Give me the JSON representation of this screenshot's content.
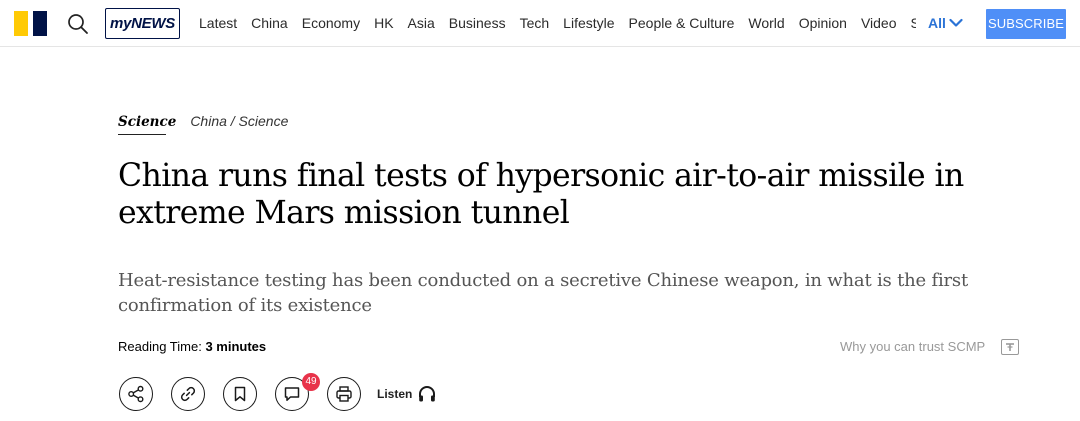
{
  "header": {
    "logo_name": "scmp-logo",
    "colors": {
      "logo_yellow": "#FFCA05",
      "logo_navy": "#001246",
      "accent": "#4f8ff7",
      "nav_more": "#2b73d6",
      "badge": "#e8334a"
    },
    "mynews_label": "myNEWS",
    "nav": [
      "Latest",
      "China",
      "Economy",
      "HK",
      "Asia",
      "Business",
      "Tech",
      "Lifestyle",
      "People & Culture",
      "World",
      "Opinion",
      "Video",
      "Sport"
    ],
    "more_label": "All",
    "subscribe_label": "SUBSCRIBE"
  },
  "article": {
    "section": "Science",
    "subsection": "China / Science",
    "headline": "China runs final tests of hypersonic air-to-air missile in extreme Mars mission tunnel",
    "dek": "Heat-resistance testing has been conducted on a secretive Chinese weapon, in what is the first confirmation of its existence",
    "reading_label": "Reading Time:",
    "reading_value": "3 minutes",
    "trust_label": "Why you can trust SCMP"
  },
  "actions": {
    "icons": [
      "share-icon",
      "link-icon",
      "bookmark-icon",
      "comment-icon",
      "print-icon",
      "headphones-icon"
    ],
    "comment_count": "49",
    "listen_label": "Listen"
  }
}
